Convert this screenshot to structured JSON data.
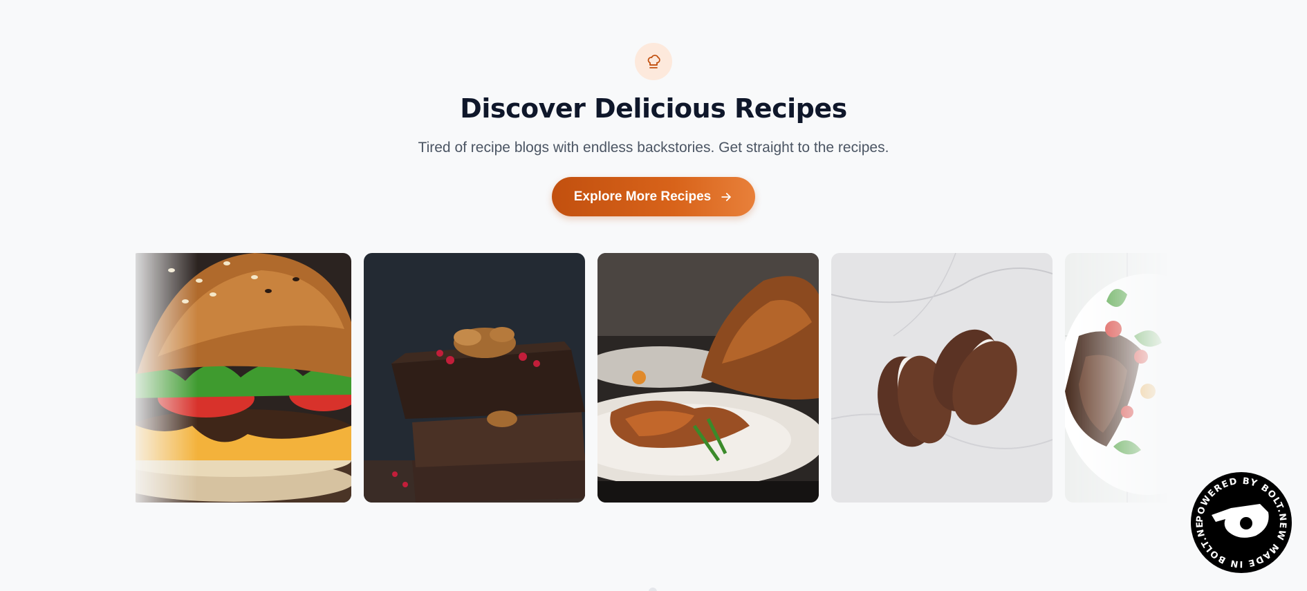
{
  "hero": {
    "icon": "chef-hat-icon",
    "title": "Discover Delicious Recipes",
    "subtitle": "Tired of recipe blogs with endless backstories. Get straight to the recipes.",
    "cta_label": "Explore More Recipes",
    "cta_icon": "arrow-right-icon",
    "accent_color": "#c2500f",
    "icon_bg_color": "#fde9dc"
  },
  "carousel": {
    "items": [
      {
        "name": "burger-image",
        "depicts": "burger"
      },
      {
        "name": "brownie-image",
        "depicts": "brownie"
      },
      {
        "name": "roast-chicken-image",
        "depicts": "roast chicken"
      },
      {
        "name": "chocolate-cookies-image",
        "depicts": "chocolate sandwich cookies"
      },
      {
        "name": "steak-salad-image",
        "depicts": "steak salad"
      }
    ]
  },
  "badge": {
    "text": "POWERED BY BOLT.NEW MADE IN BOLT.NEW",
    "icon": "bolt-logo-icon"
  }
}
